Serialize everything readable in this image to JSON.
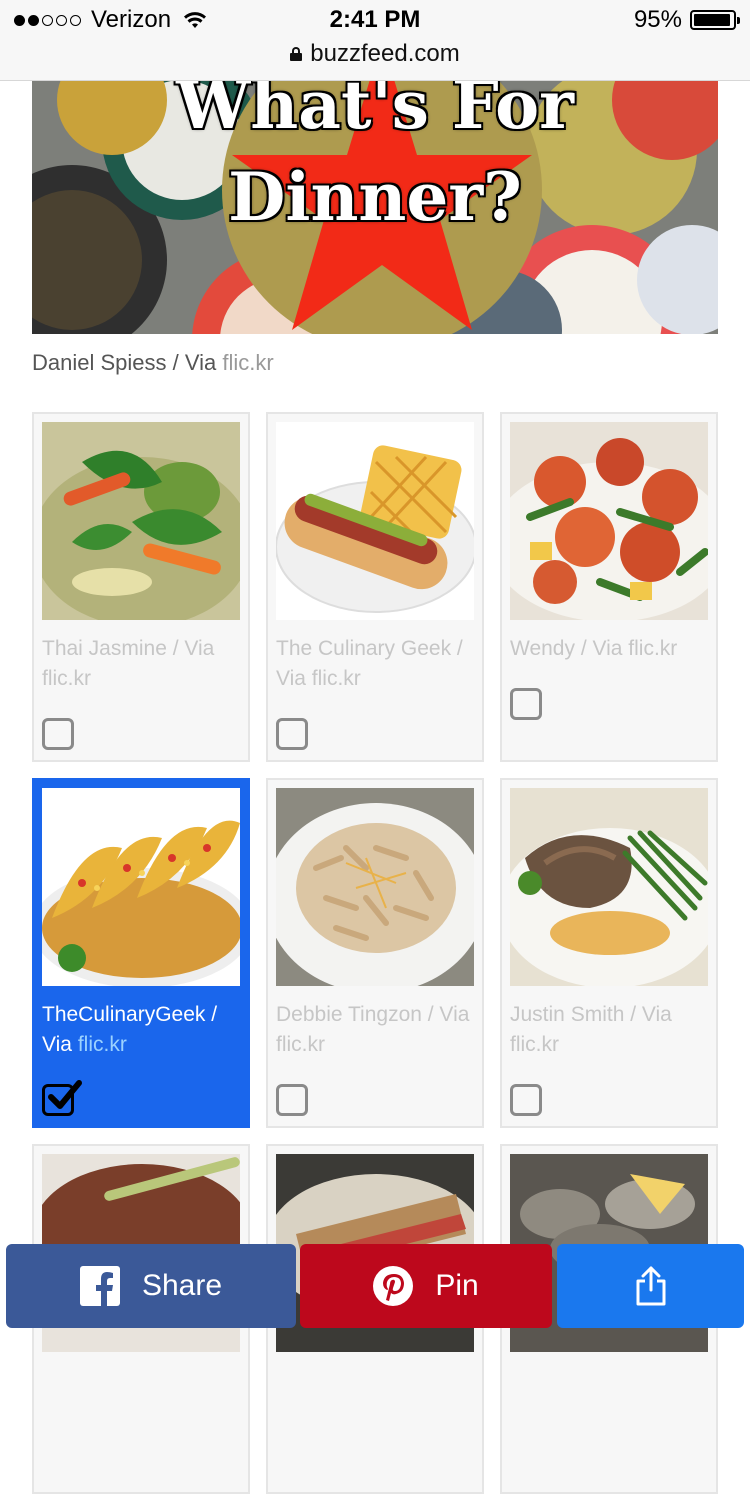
{
  "status_bar": {
    "carrier": "Verizon",
    "time": "2:41 PM",
    "battery_percent": "95%",
    "battery_level": 0.95,
    "url": "buzzfeed.com"
  },
  "hero": {
    "title_line1": "What's For",
    "title_line2": "Dinner?",
    "credit_prefix": "Daniel Spiess / Via ",
    "credit_link": "flic.kr"
  },
  "cards": [
    {
      "caption": "Thai Jasmine / Via flic.kr",
      "image": "green-curry-photo",
      "selected": false
    },
    {
      "caption": "The Culinary Geek / Via flic.kr",
      "image": "hot-dog-waffle-fries-photo",
      "selected": false
    },
    {
      "caption": "Wendy / Via flic.kr",
      "image": "sweet-sour-chicken-photo",
      "selected": false
    },
    {
      "caption_main": "TheCulinaryGeek / Via ",
      "caption_link": "flic.kr",
      "image": "tacos-rice-photo",
      "selected": true
    },
    {
      "caption": "Debbie Tingzon / Via flic.kr",
      "image": "penne-pasta-photo",
      "selected": false
    },
    {
      "caption": "Justin Smith / Via flic.kr",
      "image": "pork-chop-green-beans-photo",
      "selected": false
    },
    {
      "image": "ribs-photo",
      "selected": false
    },
    {
      "image": "sandwich-photo",
      "selected": false
    },
    {
      "image": "oysters-photo",
      "selected": false
    }
  ],
  "share_bar": {
    "facebook_label": "Share",
    "pinterest_label": "Pin",
    "share_icon": "share-upload-icon"
  },
  "colors": {
    "selected_card": "#1a66ec",
    "facebook": "#3b5998",
    "pinterest": "#bd081c",
    "share": "#1a78ee"
  }
}
